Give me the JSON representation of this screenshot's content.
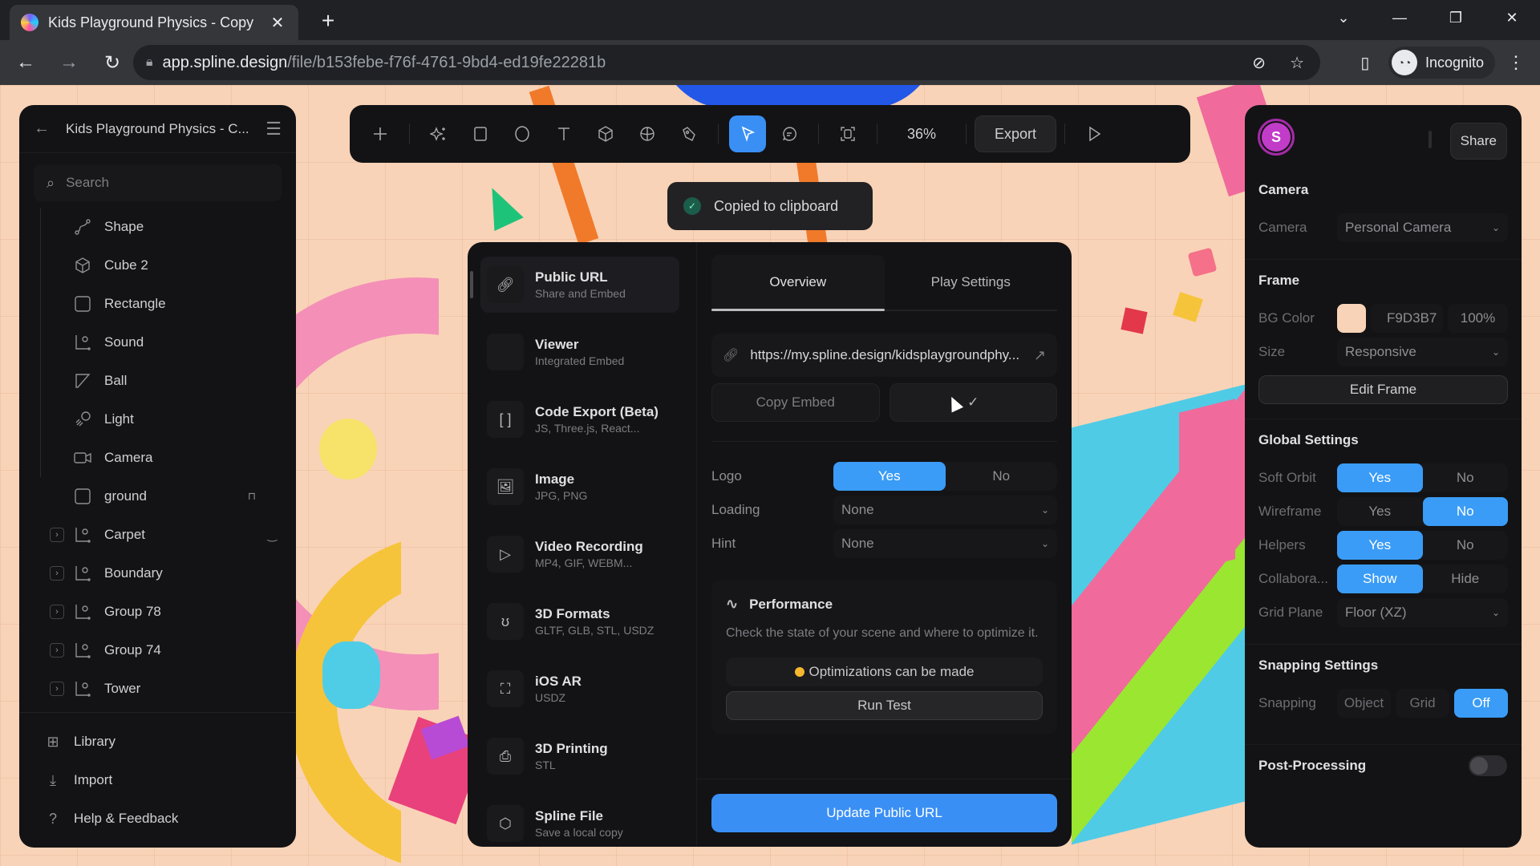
{
  "browser": {
    "tab_title": "Kids Playground Physics - Copy",
    "url_host": "app.spline.design",
    "url_path": "/file/b153febe-f76f-4761-9bd4-ed19fe22281b",
    "profile_label": "Incognito"
  },
  "left_panel": {
    "title": "Kids Playground Physics - C...",
    "search_placeholder": "Search",
    "layers": [
      {
        "name": "Shape",
        "icon": "path-icon"
      },
      {
        "name": "Cube 2",
        "icon": "cube-icon"
      },
      {
        "name": "Rectangle",
        "icon": "rectangle-icon"
      },
      {
        "name": "Sound",
        "icon": "group-icon"
      },
      {
        "name": "Ball",
        "icon": "shape-icon"
      },
      {
        "name": "Light",
        "icon": "light-icon"
      },
      {
        "name": "Camera",
        "icon": "camera-icon"
      },
      {
        "name": "ground",
        "icon": "rectangle-icon",
        "locked": true
      },
      {
        "name": "Carpet",
        "icon": "group-icon",
        "expandable": true
      },
      {
        "name": "Boundary",
        "icon": "group-icon",
        "expandable": true
      },
      {
        "name": "Group 78",
        "icon": "group-icon",
        "expandable": true
      },
      {
        "name": "Group 74",
        "icon": "group-icon",
        "expandable": true
      },
      {
        "name": "Tower",
        "icon": "group-icon",
        "expandable": true
      }
    ],
    "footer": [
      {
        "label": "Library",
        "icon": "library-icon"
      },
      {
        "label": "Import",
        "icon": "import-icon"
      },
      {
        "label": "Help & Feedback",
        "icon": "help-icon"
      }
    ]
  },
  "toolbar": {
    "zoom": "36%",
    "export_label": "Export",
    "active_tool": "select"
  },
  "toast": {
    "message": "Copied to clipboard"
  },
  "export_dialog": {
    "menu": [
      {
        "title": "Public URL",
        "subtitle": "Share and Embed",
        "active": true
      },
      {
        "title": "Viewer",
        "subtitle": "Integrated Embed"
      },
      {
        "title": "Code Export (Beta)",
        "subtitle": "JS, Three.js, React..."
      },
      {
        "title": "Image",
        "subtitle": "JPG, PNG"
      },
      {
        "title": "Video Recording",
        "subtitle": "MP4, GIF, WEBM..."
      },
      {
        "title": "3D Formats",
        "subtitle": "GLTF, GLB, STL, USDZ"
      },
      {
        "title": "iOS AR",
        "subtitle": "USDZ"
      },
      {
        "title": "3D Printing",
        "subtitle": "STL"
      },
      {
        "title": "Spline File",
        "subtitle": "Save a local copy"
      }
    ],
    "tabs": [
      "Overview",
      "Play Settings"
    ],
    "active_tab": "Overview",
    "public_url": "https://my.spline.design/kidsplaygroundphy...",
    "copy_embed_label": "Copy Embed",
    "options": {
      "logo_label": "Logo",
      "logo_yes": "Yes",
      "logo_no": "No",
      "logo_value": "Yes",
      "loading_label": "Loading",
      "loading_value": "None",
      "hint_label": "Hint",
      "hint_value": "None"
    },
    "performance": {
      "title": "Performance",
      "description": "Check the state of your scene and where to optimize it.",
      "status": "Optimizations can be made",
      "status_color": "#f5b82e",
      "run_test_label": "Run Test"
    },
    "update_label": "Update Public URL"
  },
  "right_panel": {
    "avatar_letter": "S",
    "share_label": "Share",
    "camera": {
      "title": "Camera",
      "label": "Camera",
      "value": "Personal Camera"
    },
    "frame": {
      "title": "Frame",
      "bg_label": "BG Color",
      "bg_hex": "F9D3B7",
      "bg_color": "#f9d3b7",
      "bg_alpha": "100%",
      "size_label": "Size",
      "size_value": "Responsive",
      "edit_label": "Edit Frame"
    },
    "global": {
      "title": "Global Settings",
      "rows": [
        {
          "label": "Soft Orbit",
          "a": "Yes",
          "b": "No",
          "value": "a"
        },
        {
          "label": "Wireframe",
          "a": "Yes",
          "b": "No",
          "value": "b"
        },
        {
          "label": "Helpers",
          "a": "Yes",
          "b": "No",
          "value": "a"
        },
        {
          "label": "Collabora...",
          "a": "Show",
          "b": "Hide",
          "value": "a"
        }
      ],
      "grid_label": "Grid Plane",
      "grid_value": "Floor (XZ)"
    },
    "snapping": {
      "title": "Snapping Settings",
      "label": "Snapping",
      "options": [
        "Object",
        "Grid",
        "Off"
      ],
      "value": "Off"
    },
    "post_processing": {
      "title": "Post-Processing",
      "enabled": false
    }
  },
  "colors": {
    "accent": "#3a8ff5",
    "panel_bg": "#131315",
    "canvas_bg": "#f9d3b7"
  }
}
